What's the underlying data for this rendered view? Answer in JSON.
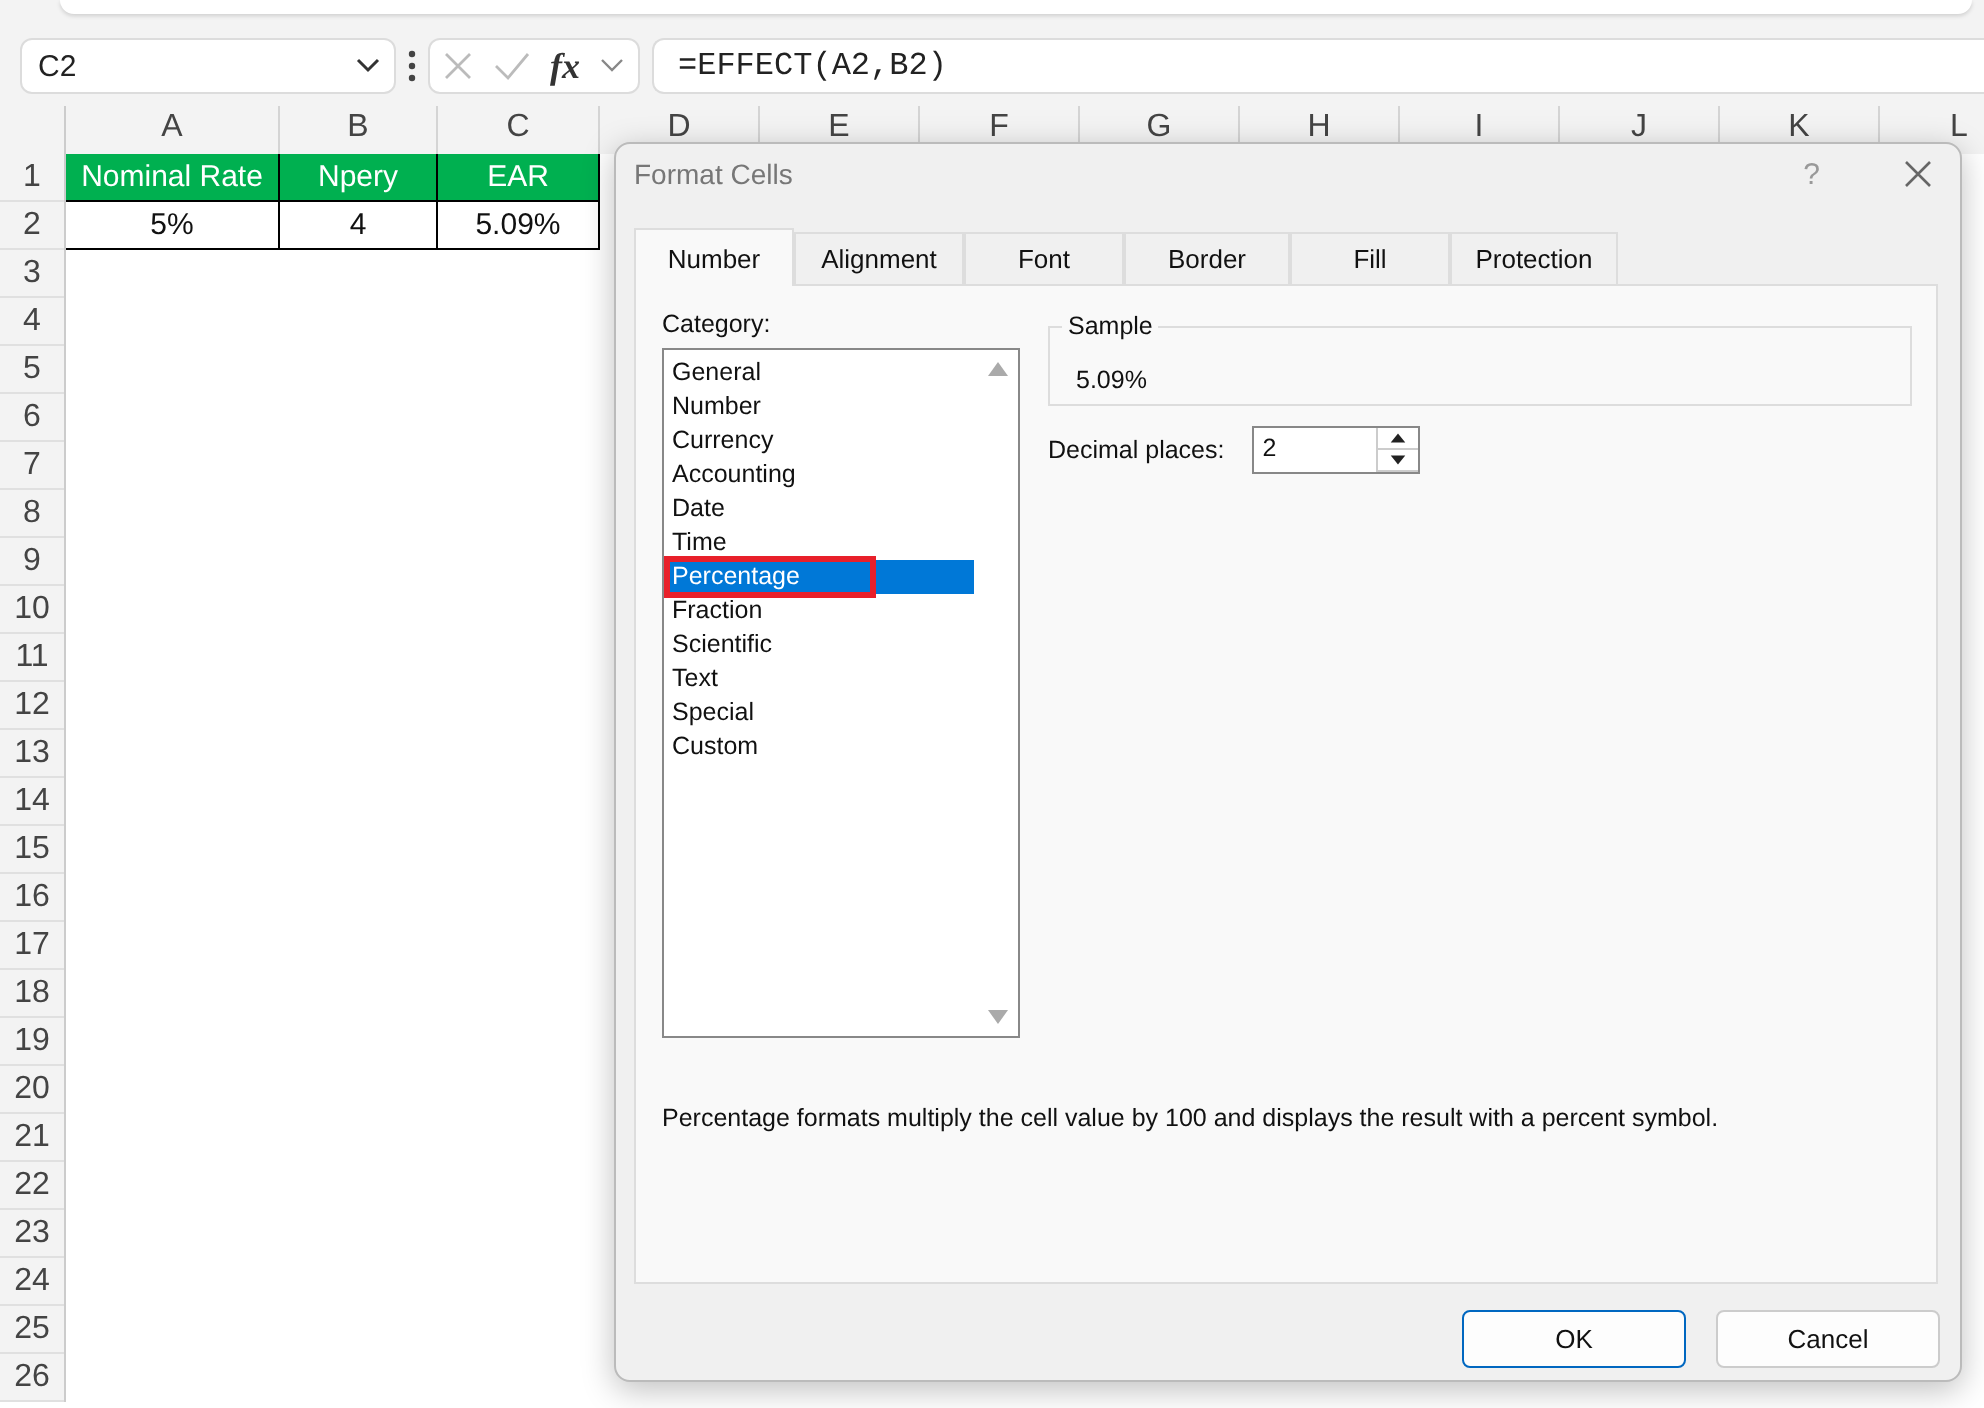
{
  "name_box": {
    "value": "C2"
  },
  "formula_bar": {
    "fx_label": "fx",
    "formula": "=EFFECT(A2,B2)"
  },
  "sheet": {
    "columns": [
      "A",
      "B",
      "C",
      "D",
      "E",
      "F",
      "G",
      "H",
      "I",
      "J",
      "K",
      "L"
    ],
    "row_numbers": [
      "1",
      "2",
      "3",
      "4",
      "5",
      "6",
      "7",
      "8",
      "9",
      "10",
      "11",
      "12",
      "13",
      "14",
      "15",
      "16",
      "17",
      "18",
      "19",
      "20",
      "21",
      "22",
      "23",
      "24",
      "25",
      "26"
    ],
    "header_row": [
      "Nominal Rate",
      "Npery",
      "EAR"
    ],
    "data_rows": [
      [
        "5%",
        "4",
        "5.09%"
      ]
    ]
  },
  "dialog": {
    "title": "Format Cells",
    "help": "?",
    "tabs": [
      {
        "label": "Number",
        "selected": true
      },
      {
        "label": "Alignment",
        "selected": false
      },
      {
        "label": "Font",
        "selected": false
      },
      {
        "label": "Border",
        "selected": false
      },
      {
        "label": "Fill",
        "selected": false
      },
      {
        "label": "Protection",
        "selected": false
      }
    ],
    "category": {
      "label": "Category:",
      "items": [
        {
          "label": "General",
          "selected": false,
          "highlighted": false
        },
        {
          "label": "Number",
          "selected": false,
          "highlighted": false
        },
        {
          "label": "Currency",
          "selected": false,
          "highlighted": false
        },
        {
          "label": "Accounting",
          "selected": false,
          "highlighted": false
        },
        {
          "label": "Date",
          "selected": false,
          "highlighted": false
        },
        {
          "label": "Time",
          "selected": false,
          "highlighted": false
        },
        {
          "label": "Percentage",
          "selected": true,
          "highlighted": true
        },
        {
          "label": "Fraction",
          "selected": false,
          "highlighted": false
        },
        {
          "label": "Scientific",
          "selected": false,
          "highlighted": false
        },
        {
          "label": "Text",
          "selected": false,
          "highlighted": false
        },
        {
          "label": "Special",
          "selected": false,
          "highlighted": false
        },
        {
          "label": "Custom",
          "selected": false,
          "highlighted": false
        }
      ]
    },
    "sample": {
      "legend": "Sample",
      "value": "5.09%"
    },
    "decimal_places": {
      "label": "Decimal places:",
      "value": "2"
    },
    "description": "Percentage formats multiply the cell value by 100 and displays the result with a percent symbol.",
    "buttons": [
      {
        "label": "OK",
        "default": true
      },
      {
        "label": "Cancel",
        "default": false
      }
    ]
  }
}
